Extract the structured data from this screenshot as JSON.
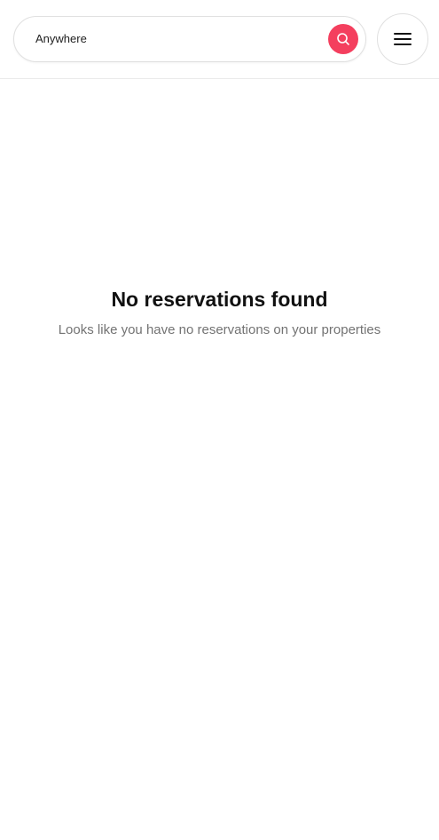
{
  "navbar": {
    "search": {
      "label": "Anywhere",
      "icon": "search-icon",
      "accent_color": "#f43f5e"
    },
    "menu": {
      "icon": "menu-icon"
    }
  },
  "empty_state": {
    "title": "No reservations found",
    "subtitle": "Looks like you have no reservations on your properties"
  }
}
